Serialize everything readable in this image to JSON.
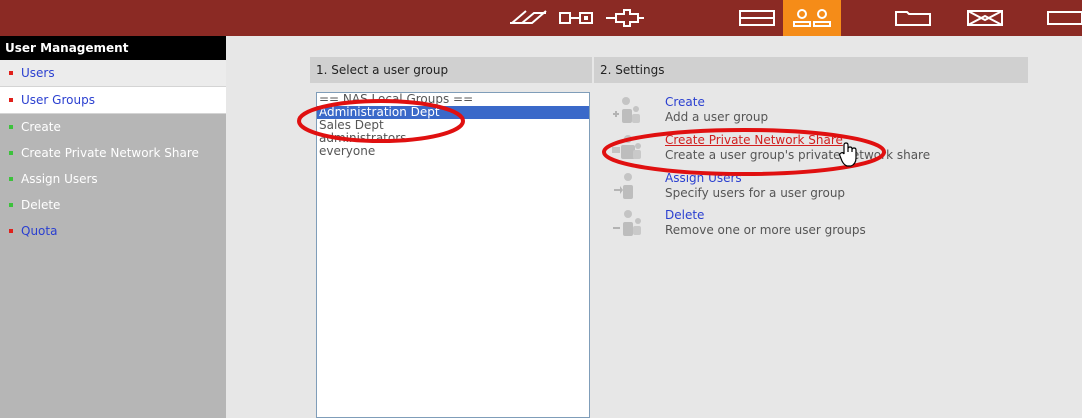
{
  "sidebar": {
    "title": "User Management",
    "items": [
      {
        "label": "Users"
      },
      {
        "label": "User Groups"
      },
      {
        "label": "Create"
      },
      {
        "label": "Create Private Network Share"
      },
      {
        "label": "Assign Users"
      },
      {
        "label": "Delete"
      },
      {
        "label": "Quota"
      }
    ]
  },
  "topbar": {
    "icons": [
      "network-icon",
      "device-icon",
      "plug-icon",
      "storage-icon",
      "users-icon",
      "folder-icon",
      "mail-icon",
      "more-icon"
    ],
    "active_icon": "users-icon"
  },
  "panel1": {
    "header": "1. Select a user group",
    "groups": [
      "== NAS Local Groups ==",
      "Administration Dept",
      "Sales Dept",
      "administrators",
      "everyone"
    ],
    "selected": "Administration Dept"
  },
  "panel2": {
    "header": "2. Settings",
    "actions": [
      {
        "title": "Create",
        "desc": "Add a user group"
      },
      {
        "title": "Create Private Network Share",
        "desc": "Create a user group's private network share"
      },
      {
        "title": "Assign Users",
        "desc": "Specify users for a user group"
      },
      {
        "title": "Delete",
        "desc": "Remove one or more user groups"
      }
    ]
  },
  "colors": {
    "topbar": "#8b2a24",
    "active_tab": "#f58c18",
    "link": "#2a3fd0",
    "highlight": "#d11f1f",
    "annotation": "#e01010"
  }
}
